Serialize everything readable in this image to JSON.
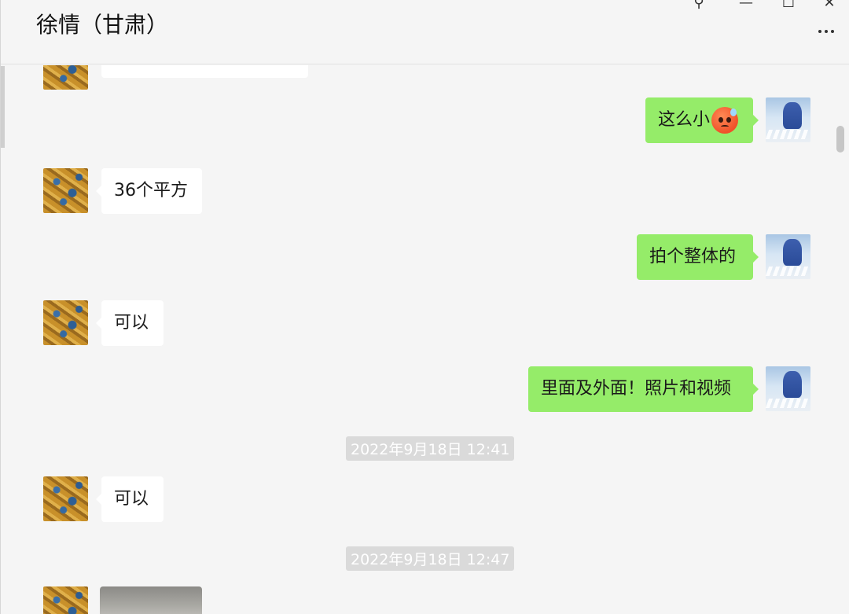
{
  "window": {
    "title": "徐情（甘肃）",
    "controls": {
      "pin": "⚲",
      "minimize": "—",
      "maximize": "☐",
      "close": "✕"
    }
  },
  "messages": [
    {
      "side": "left",
      "text": "36个平方"
    },
    {
      "side": "right",
      "text": "这么小",
      "emoji": "anxious-sweat-face-icon"
    },
    {
      "side": "right",
      "text": "拍个整体的"
    },
    {
      "side": "left",
      "text": "可以"
    },
    {
      "side": "right",
      "text": "里面及外面！照片和视频"
    },
    {
      "side": "timestamp",
      "text": "2022年9月18日 12:41"
    },
    {
      "side": "left",
      "text": "可以"
    },
    {
      "side": "timestamp",
      "text": "2022年9月18日 12:47"
    }
  ],
  "colors": {
    "outgoing_bubble": "#95ec69",
    "incoming_bubble": "#ffffff",
    "background": "#f5f5f5",
    "timestamp_bg": "#dadada"
  }
}
